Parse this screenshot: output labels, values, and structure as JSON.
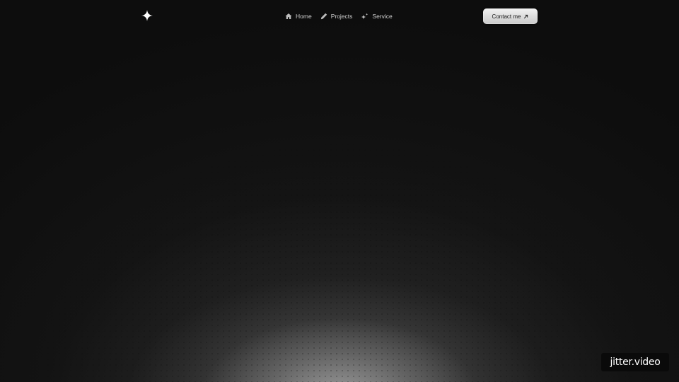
{
  "nav": {
    "items": [
      {
        "label": "Home",
        "icon": "home-icon"
      },
      {
        "label": "Projects",
        "icon": "pencil-icon"
      },
      {
        "label": "Service",
        "icon": "sparkles-icon"
      }
    ]
  },
  "cta": {
    "label": "Contact me",
    "icon": "arrow-up-right-icon"
  },
  "logo": {
    "icon": "four-point-star-icon"
  },
  "watermark": {
    "text": "jitter.video"
  },
  "colors": {
    "background": "#0d0d0d",
    "nav_text": "#cfcfcf",
    "button_bg": "#e0e0e0",
    "button_text": "#1a1a1a"
  }
}
